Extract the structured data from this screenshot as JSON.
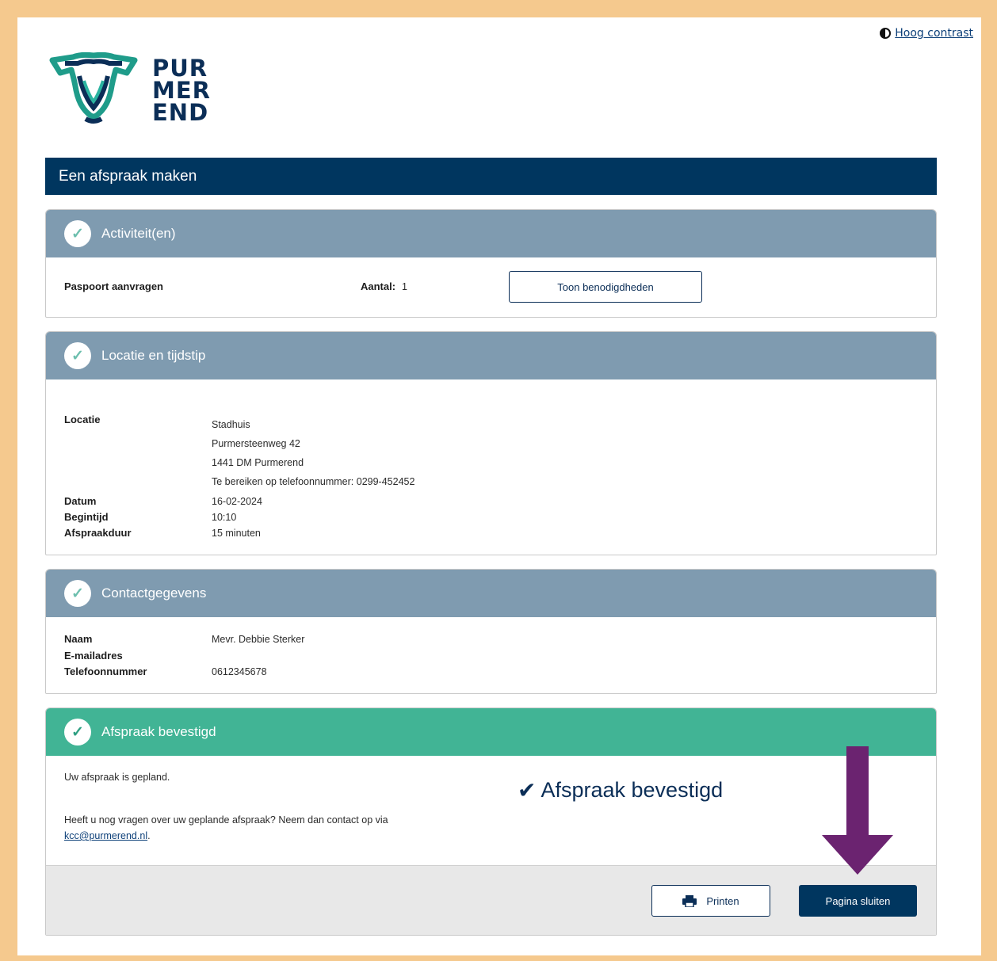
{
  "header": {
    "high_contrast_label": "Hoog contrast",
    "logo_lines": [
      "PUR",
      "MER",
      "END"
    ],
    "page_title": "Een afspraak maken"
  },
  "activities": {
    "title": "Activiteit(en)",
    "item_name": "Paspoort aanvragen",
    "quantity_label": "Aantal:",
    "quantity_value": "1",
    "requirements_button": "Toon benodigdheden"
  },
  "location_time": {
    "title": "Locatie en tijdstip",
    "location_label": "Locatie",
    "location_lines": [
      "Stadhuis",
      "Purmersteenweg 42",
      "1441 DM Purmerend",
      "Te bereiken op telefoonnummer: 0299-452452"
    ],
    "date_label": "Datum",
    "date_value": "16-02-2024",
    "start_label": "Begintijd",
    "start_value": "10:10",
    "duration_label": "Afspraakduur",
    "duration_value": "15 minuten"
  },
  "contact": {
    "title": "Contactgegevens",
    "name_label": "Naam",
    "name_value": "Mevr. Debbie Sterker",
    "email_label": "E-mailadres",
    "email_value": "",
    "phone_label": "Telefoonnummer",
    "phone_value": "0612345678"
  },
  "confirmation": {
    "title": "Afspraak bevestigd",
    "planned_text": "Uw afspraak is gepland.",
    "questions_text": "Heeft u nog vragen over uw geplande afspraak? Neem dan contact op via",
    "email_link": "kcc@purmerend.nl",
    "period": ".",
    "big_label": "Afspraak bevestigd",
    "print_button": "Printen",
    "close_button": "Pagina sluiten"
  },
  "colors": {
    "navy": "#00365f",
    "panel_header": "#7f9bb0",
    "confirm_header": "#41b495",
    "annotation_arrow": "#6b2370",
    "frame_border": "#f5c98e"
  }
}
